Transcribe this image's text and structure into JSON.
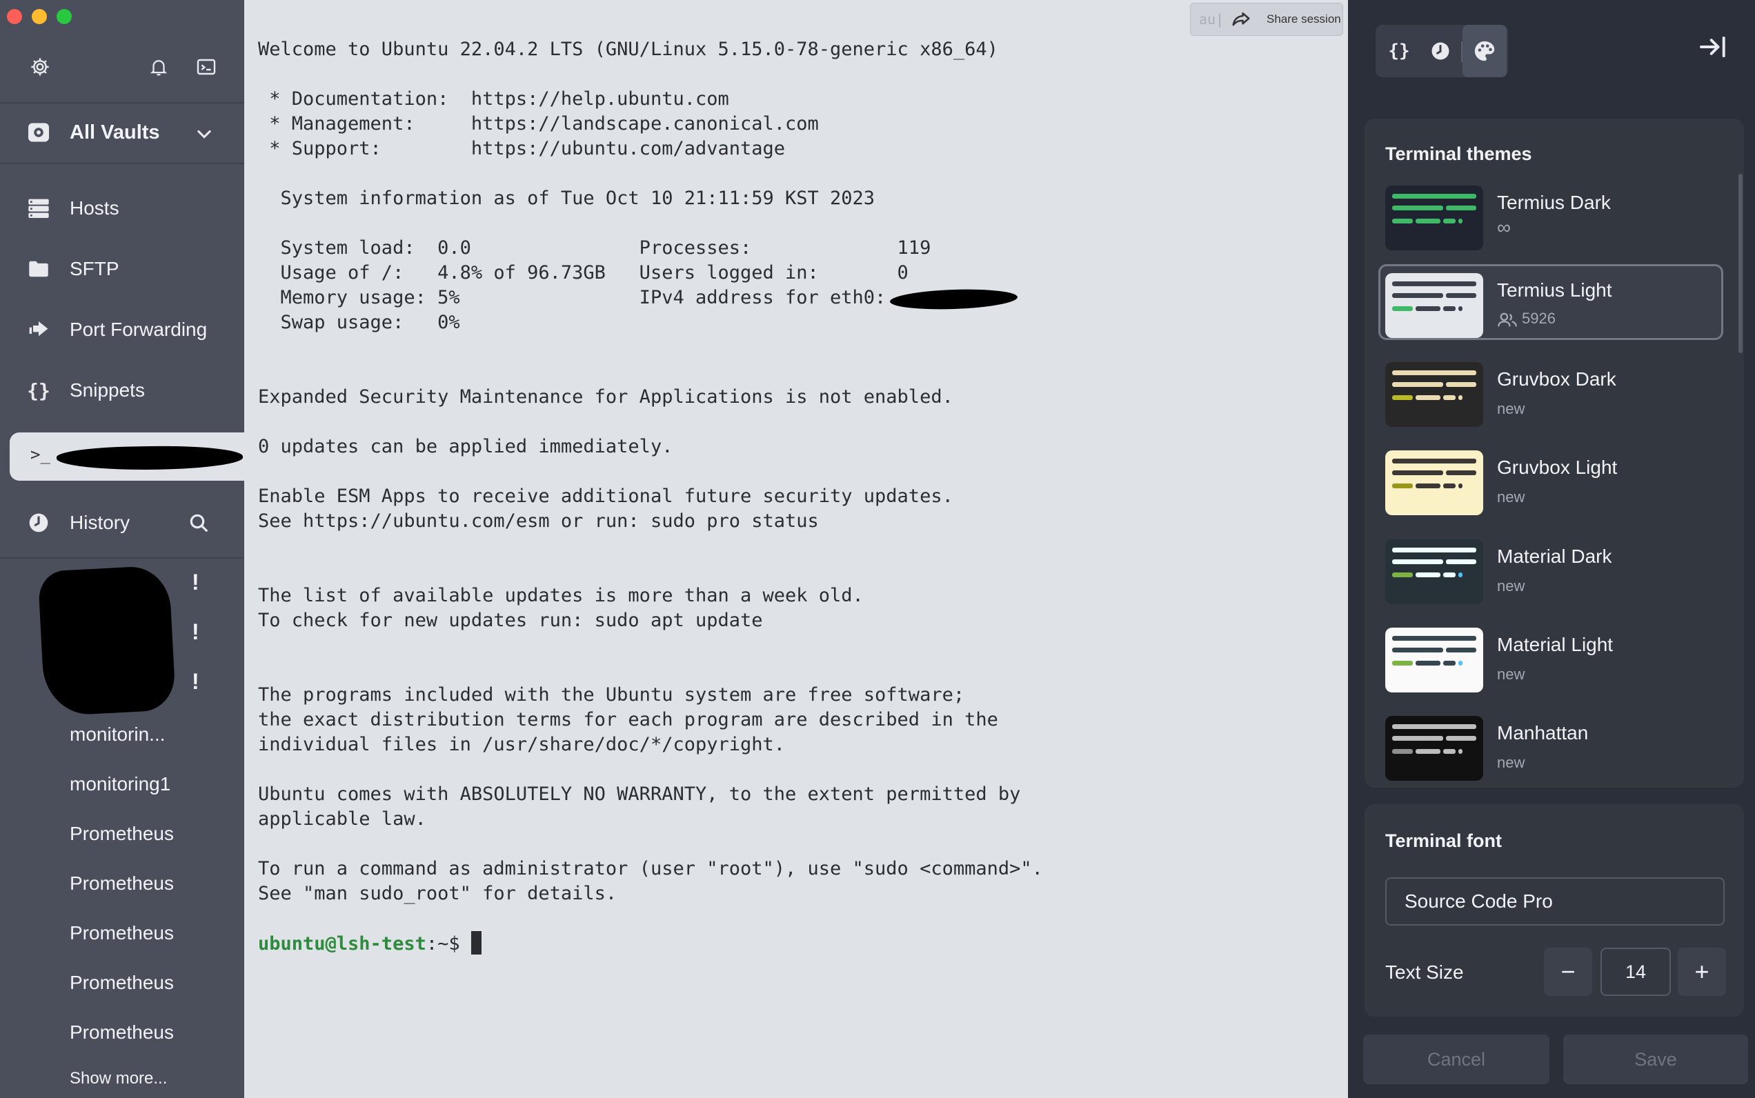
{
  "sidebar": {
    "vault_label": "All Vaults",
    "nav": [
      {
        "label": "Hosts",
        "icon": "hosts-icon"
      },
      {
        "label": "SFTP",
        "icon": "folder-icon"
      },
      {
        "label": "Port Forwarding",
        "icon": "port-forwarding-icon"
      },
      {
        "label": "Snippets",
        "icon": "snippets-icon"
      }
    ],
    "session_prompt": ">_",
    "history_label": "History",
    "history_items": [
      "monitorin...",
      "monitoring1",
      "Prometheus",
      "Prometheus",
      "Prometheus",
      "Prometheus",
      "Prometheus"
    ],
    "alert_marks": [
      "!",
      "!",
      "!"
    ],
    "show_more": "Show more..."
  },
  "terminal": {
    "share_faded": "au|",
    "share_label": "Share session",
    "output": "Welcome to Ubuntu 22.04.2 LTS (GNU/Linux 5.15.0-78-generic x86_64)\n\n * Documentation:  https://help.ubuntu.com\n * Management:     https://landscape.canonical.com\n * Support:        https://ubuntu.com/advantage\n\n  System information as of Tue Oct 10 21:11:59 KST 2023\n\n  System load:  0.0               Processes:             119\n  Usage of /:   4.8% of 96.73GB   Users logged in:       0\n  Memory usage: 5%                IPv4 address for eth0: \n  Swap usage:   0%\n\n\nExpanded Security Maintenance for Applications is not enabled.\n\n0 updates can be applied immediately.\n\nEnable ESM Apps to receive additional future security updates.\nSee https://ubuntu.com/esm or run: sudo pro status\n\n\nThe list of available updates is more than a week old.\nTo check for new updates run: sudo apt update\n\n\nThe programs included with the Ubuntu system are free software;\nthe exact distribution terms for each program are described in the\nindividual files in /usr/share/doc/*/copyright.\n\nUbuntu comes with ABSOLUTELY NO WARRANTY, to the extent permitted by\napplicable law.\n\nTo run a command as administrator (user \"root\"), use \"sudo <command>\".\nSee \"man sudo_root\" for details.\n\n",
    "prompt_user": "ubuntu@lsh-test",
    "prompt_path": ":~$ "
  },
  "panel": {
    "themes_title": "Terminal themes",
    "themes": [
      {
        "name": "Termius Dark",
        "sub": "∞",
        "bg": "#1f2430",
        "accent": "#3fb968",
        "line": "#3fb968",
        "selected": false
      },
      {
        "name": "Termius Light",
        "sub": "5926",
        "bg": "#e4e7ec",
        "accent": "#3fb968",
        "line": "#3d414c",
        "selected": true
      },
      {
        "name": "Gruvbox Dark",
        "sub": "new",
        "bg": "#282828",
        "accent": "#b8bb26",
        "line": "#ebdbb2",
        "selected": false
      },
      {
        "name": "Gruvbox Light",
        "sub": "new",
        "bg": "#fbf1c7",
        "accent": "#98971a",
        "line": "#3c3836",
        "selected": false
      },
      {
        "name": "Material Dark",
        "sub": "new",
        "bg": "#263238",
        "accent": "#7cb342",
        "line": "#eeffff",
        "selected": false
      },
      {
        "name": "Material Light",
        "sub": "new",
        "bg": "#fafafa",
        "accent": "#7cb342",
        "line": "#37474f",
        "selected": false
      },
      {
        "name": "Manhattan",
        "sub": "new",
        "bg": "#111111",
        "accent": "#8f8f8f",
        "line": "#bdbdbd",
        "selected": false
      }
    ],
    "font_title": "Terminal font",
    "font_value": "Source Code Pro",
    "text_size_label": "Text Size",
    "text_size_value": "14",
    "minus": "−",
    "plus": "+",
    "cancel_label": "Cancel",
    "save_label": "Save"
  }
}
